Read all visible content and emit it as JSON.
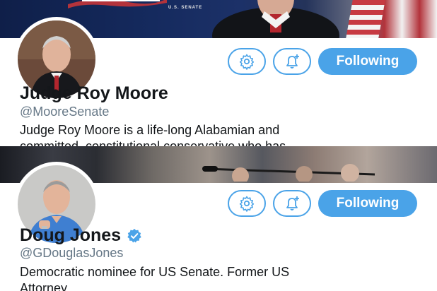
{
  "profiles": [
    {
      "name": "Judge Roy Moore",
      "handle": "@MooreSenate",
      "bio_line1": "Judge Roy Moore is a life-long Alabamian and",
      "bio_line2": "committed, constitutional conservative who has",
      "follow_label": "Following",
      "verified": false,
      "banner_text": "U.S. SENATE"
    },
    {
      "name": "Doug Jones",
      "handle": "@GDouglasJones",
      "bio_line1": "Democratic nominee for US Senate. Former US",
      "bio_line2": "Attorney.",
      "follow_label": "Following",
      "verified": true
    }
  ],
  "icons": {
    "settings": "gear-icon",
    "notifications": "bell-plus-icon",
    "verified": "verified-badge-icon"
  },
  "colors": {
    "accent": "#4aa3e8",
    "handle_gray": "#657786",
    "text": "#14171a"
  }
}
